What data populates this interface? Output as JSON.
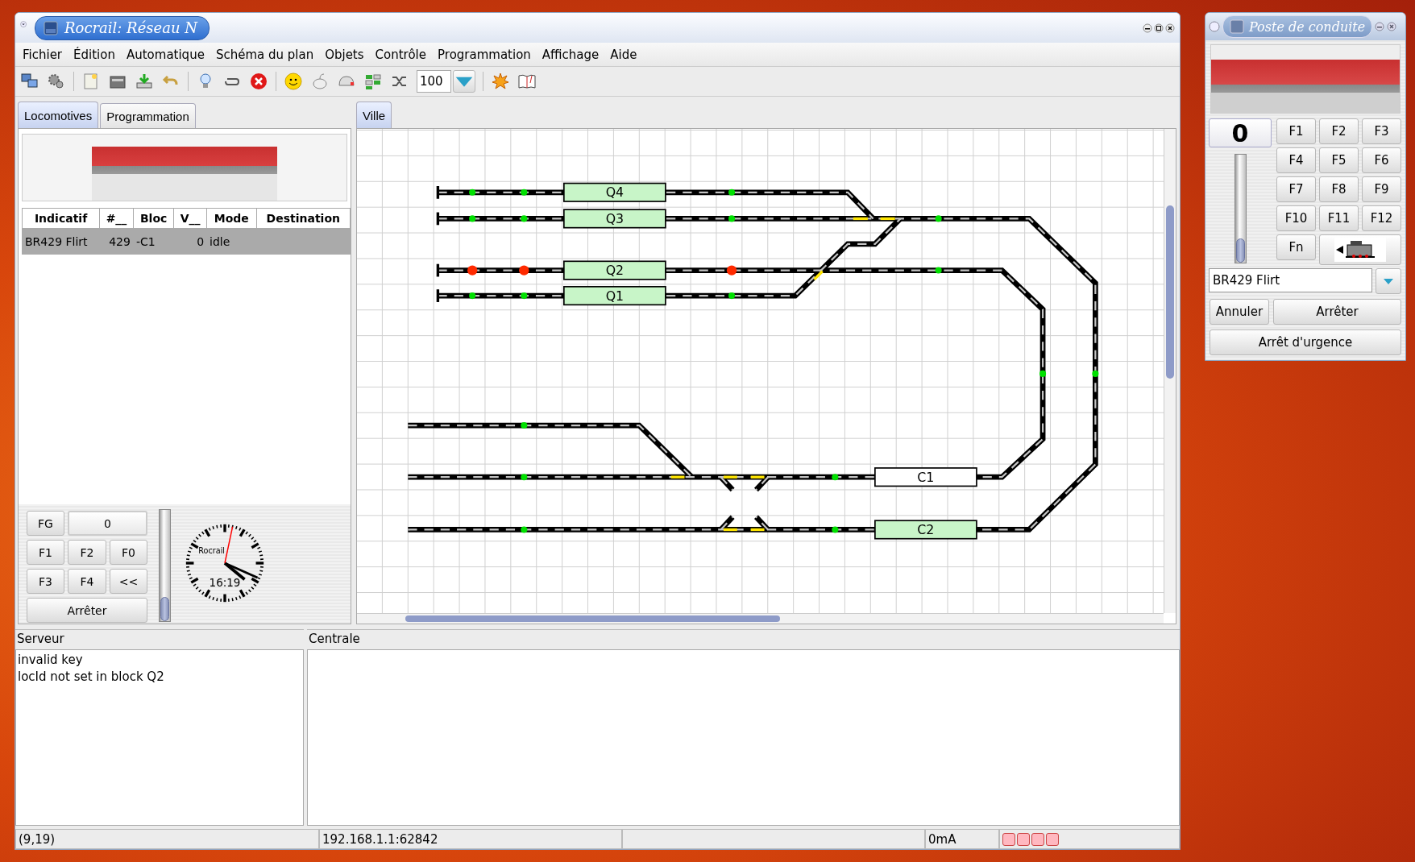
{
  "main_window": {
    "title": "Rocrail: Réseau N"
  },
  "menu": [
    "Fichier",
    "Édition",
    "Automatique",
    "Schéma du plan",
    "Objets",
    "Contrôle",
    "Programmation",
    "Affichage",
    "Aide"
  ],
  "toolbar": {
    "zoom": "100"
  },
  "left_tabs": [
    {
      "label": "Locomotives",
      "selected": true
    },
    {
      "label": "Programmation",
      "selected": false
    }
  ],
  "loco_table": {
    "columns": [
      "Indicatif",
      "#__",
      "Bloc",
      "V__",
      "Mode",
      "Destination"
    ],
    "rows": [
      {
        "cells": [
          "BR429 Flirt",
          "429",
          "-C1",
          "0",
          "idle"
        ],
        "selected": true
      }
    ]
  },
  "loco_controls": {
    "fg": "FG",
    "speed": "0",
    "rows": [
      [
        "F1",
        "F2",
        "F0"
      ],
      [
        "F3",
        "F4",
        "<<"
      ]
    ],
    "stop": "Arrêter",
    "level": 0
  },
  "clock": {
    "logo": "Rocrail",
    "time": "16:19"
  },
  "plan_tabs": [
    {
      "label": "Ville",
      "selected": true
    }
  ],
  "blocks": [
    {
      "label": "Q4",
      "occupied": false
    },
    {
      "label": "Q3",
      "occupied": false
    },
    {
      "label": "Q2",
      "occupied": false
    },
    {
      "label": "Q1",
      "occupied": false
    },
    {
      "label": "C1",
      "occupied": true
    },
    {
      "label": "C2",
      "occupied": false
    }
  ],
  "signals": [
    {
      "color": "#00e000"
    },
    {
      "color": "#00e000"
    },
    {
      "color": "#00e000"
    },
    {
      "color": "#00e000"
    },
    {
      "color": "#00e000"
    },
    {
      "color": "#00e000"
    },
    {
      "color": "#00e000"
    },
    {
      "color": "#ff2a00"
    },
    {
      "color": "#ff2a00"
    },
    {
      "color": "#ff2a00"
    },
    {
      "color": "#00e000"
    },
    {
      "color": "#00e000"
    },
    {
      "color": "#00e000"
    },
    {
      "color": "#00e000"
    },
    {
      "color": "#00e000"
    },
    {
      "color": "#00e000"
    },
    {
      "color": "#00e000"
    },
    {
      "color": "#00e000"
    },
    {
      "color": "#00e000"
    },
    {
      "color": "#00e000"
    },
    {
      "color": "#00e000"
    }
  ],
  "server_log": {
    "title": "Serveur",
    "lines": [
      "invalid key",
      "locId not set in block Q2"
    ]
  },
  "central_log": {
    "title": "Centrale"
  },
  "status_bar": {
    "position": "(9,19)",
    "address": "192.168.1.1:62842",
    "current": "0mA"
  },
  "throttle": {
    "title": "Poste de conduite",
    "speed": "0",
    "functions": [
      "F1",
      "F2",
      "F3",
      "F4",
      "F5",
      "F6",
      "F7",
      "F8",
      "F9",
      "F10",
      "F11",
      "F12"
    ],
    "fn": "Fn",
    "level": 0,
    "loco": "BR429 Flirt",
    "buttons": [
      "Annuler",
      "Arrêter"
    ],
    "emergency": "Arrêt d'urgence"
  }
}
